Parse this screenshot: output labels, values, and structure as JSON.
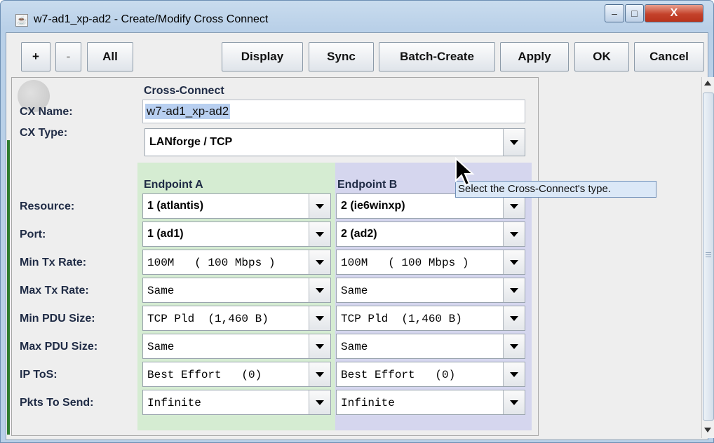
{
  "window": {
    "title": "w7-ad1_xp-ad2 - Create/Modify Cross Connect",
    "controls": {
      "minimize": "‒",
      "maximize": "□",
      "close": "X"
    }
  },
  "toolbar": {
    "plus": "+",
    "minus": "-",
    "all": "All",
    "display": "Display",
    "sync": "Sync",
    "batch_create": "Batch-Create",
    "apply": "Apply",
    "ok": "OK",
    "cancel": "Cancel"
  },
  "form": {
    "section_title": "Cross-Connect",
    "cx_name_label": "CX Name:",
    "cx_name_value": "w7-ad1_xp-ad2",
    "cx_type_label": "CX Type:",
    "cx_type_value": "LANforge / TCP",
    "endpoint_a_title": "Endpoint A",
    "endpoint_b_title": "Endpoint B",
    "rows": [
      {
        "label": "Resource:",
        "a": "1 (atlantis)",
        "b": "2 (ie6winxp)"
      },
      {
        "label": "Port:",
        "a": "1 (ad1)",
        "b": "2 (ad2)"
      },
      {
        "label": "Min Tx Rate:",
        "a": "100M   ( 100 Mbps )",
        "b": "100M   ( 100 Mbps )"
      },
      {
        "label": "Max Tx Rate:",
        "a": "Same",
        "b": "Same"
      },
      {
        "label": "Min PDU Size:",
        "a": "TCP Pld  (1,460 B)",
        "b": "TCP Pld  (1,460 B)"
      },
      {
        "label": "Max PDU Size:",
        "a": "Same",
        "b": "Same"
      },
      {
        "label": "IP ToS:",
        "a": "Best Effort   (0)",
        "b": "Best Effort   (0)"
      },
      {
        "label": "Pkts To Send:",
        "a": "Infinite",
        "b": "Infinite"
      }
    ]
  },
  "tooltip": "Select the Cross-Connect's type.",
  "colors": {
    "endpoint_a_bg": "#d5ecd2",
    "endpoint_b_bg": "#d5d6ee",
    "label_color": "#1f2b45",
    "close_button": "#c4422b"
  },
  "icons": {
    "app": "java-app-icon",
    "cursor": "mouse-pointer-icon",
    "logo": "circle-one-icon"
  }
}
